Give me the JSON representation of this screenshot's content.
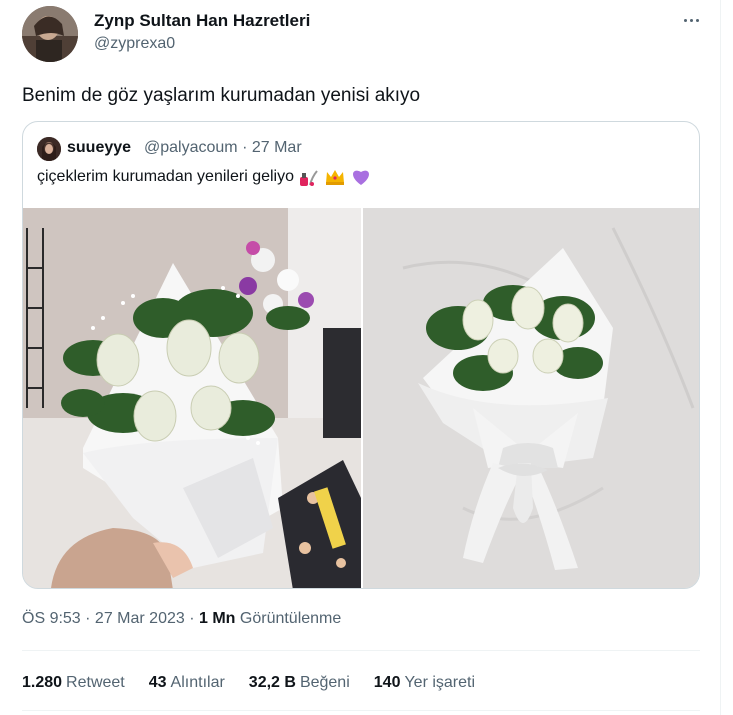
{
  "author": {
    "name": "Zynp Sultan Han Hazretleri",
    "handle": "@zyprexa0"
  },
  "tweet": {
    "text": "Benim de göz yaşlarım kurumadan yenisi akıyo"
  },
  "quoted": {
    "name": "suueyye",
    "handle": "@palyacoum",
    "separator": "·",
    "date": "27 Mar",
    "text": "çiçeklerim kurumadan yenileri geliyo",
    "emojis": [
      "nail-polish-icon",
      "crown-icon",
      "purple-heart-icon"
    ]
  },
  "meta": {
    "time": "ÖS 9:53 · 27 Mar 2023 · ",
    "views_count": "1 Mn",
    "views_label": "Görüntülenme"
  },
  "stats": {
    "retweets_count": "1.280",
    "retweets_label": "Retweet",
    "quotes_count": "43",
    "quotes_label": "Alıntılar",
    "likes_count": "32,2 B",
    "likes_label": "Beğeni",
    "bookmarks_count": "140",
    "bookmarks_label": "Yer işareti"
  },
  "colors": {
    "text": "#0f1419",
    "secondary": "#536471",
    "border": "#cfd9de",
    "heart": "#a970e0"
  }
}
